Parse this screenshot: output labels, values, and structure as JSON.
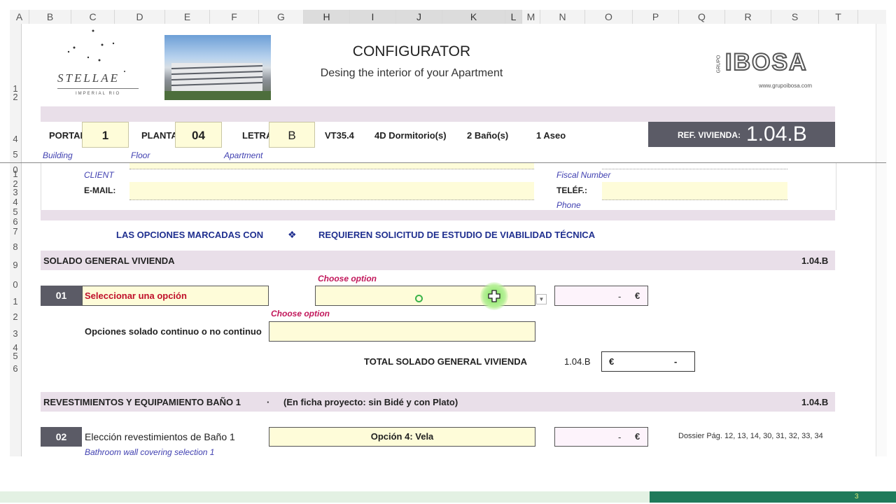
{
  "columns": [
    "A",
    "B",
    "C",
    "D",
    "E",
    "F",
    "G",
    "H",
    "I",
    "J",
    "K",
    "L",
    "M",
    "N",
    "O",
    "P",
    "Q",
    "R",
    "S",
    "T"
  ],
  "rows": [
    "1",
    "2",
    "4",
    "5",
    "0",
    "1",
    "2",
    "3",
    "4",
    "5",
    "6",
    "7",
    "8",
    "9",
    "0",
    "1",
    "2",
    "3",
    "4",
    "5",
    "6"
  ],
  "brand": {
    "logo_text": "STELLAE",
    "logo_sub": "IMPERIAL RIO",
    "grupo": "GRUPO",
    "ibosa": "IBOSA",
    "url": "www.grupoibosa.com"
  },
  "header": {
    "title": "CONFIGURATOR",
    "subtitle": "Desing the interior of your Apartment"
  },
  "unit": {
    "portal_label": "PORTAL",
    "portal": "1",
    "planta_label": "PLANTA",
    "planta": "04",
    "letra_label": "LETRA",
    "letra": "B",
    "code": "VT35.4",
    "rooms": "4D Dormitorio(s)",
    "baths": "2 Baño(s)",
    "aseo": "1 Aseo",
    "ref_label": "REF. VIVIENDA:",
    "ref": "1.04.B",
    "building": "Building",
    "floor": "Floor",
    "apartment": "Apartment"
  },
  "client": {
    "client_label": "CLIENT",
    "email_label": "E-MAIL:",
    "fiscal_label": "Fiscal Number",
    "phone_label": "TELÉF.:",
    "phone_en": "Phone"
  },
  "notice": {
    "left": "LAS OPCIONES MARCADAS CON",
    "symbol": "❖",
    "right": "REQUIEREN SOLICITUD DE ESTUDIO DE VIABILIDAD TÉCNICA"
  },
  "solado": {
    "section": "SOLADO GENERAL VIVIENDA",
    "ref": "1.04.B",
    "num": "01",
    "select_text": "Seleccionar una opción",
    "choose1": "Choose option",
    "choose2": "Choose option",
    "options_label": "Opciones solado continuo o no continuo",
    "price_dash": "-",
    "price_cur": "€",
    "total_label": "TOTAL SOLADO GENERAL VIVIENDA",
    "total_ref": "1.04.B",
    "total_cur": "€",
    "total_dash": "-"
  },
  "bano": {
    "section": "REVESTIMIENTOS Y EQUIPAMIENTO BAÑO 1",
    "sep": "·",
    "note": "(En ficha proyecto: sin Bidé y con Plato)",
    "ref": "1.04.B",
    "num": "02",
    "label": "Elección revestimientos de Baño 1",
    "label_en": "Bathroom wall covering selection 1",
    "option": "Opción 4: Vela",
    "price_dash": "-",
    "price_cur": "€",
    "dossier": "Dossier Pág. 12, 13, 14, 30, 31, 32, 33, 34"
  },
  "footer": {
    "page": "3"
  },
  "colors": {
    "band": "#e9dfe9",
    "yellow": "#fefcd9",
    "dark": "#5b5b66",
    "green": "#1f7a5a"
  }
}
